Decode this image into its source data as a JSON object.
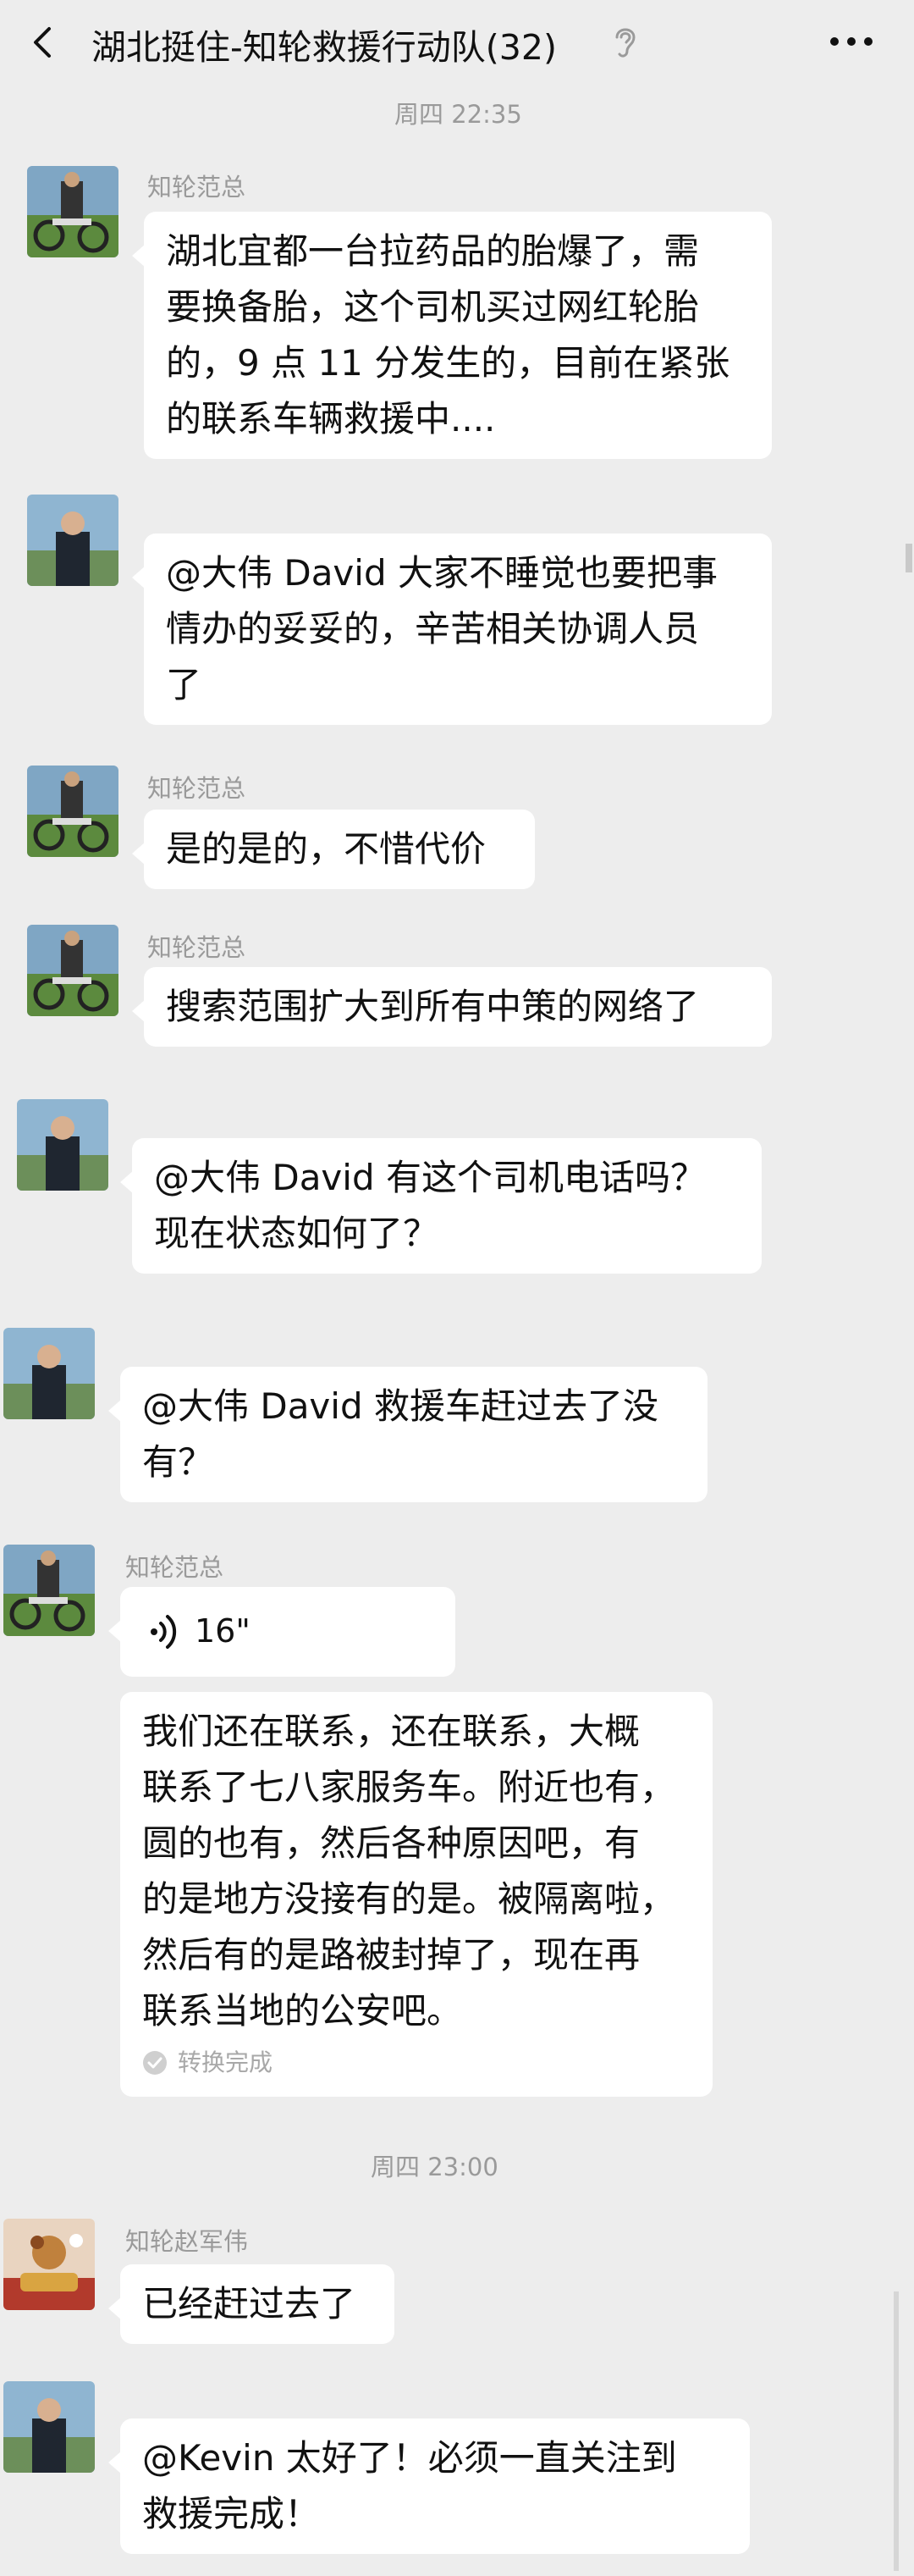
{
  "header": {
    "title": "湖北挺住-知轮救援行动队(32)"
  },
  "time_separators": [
    "周四 22:35",
    "周四 23:00"
  ],
  "messages": [
    {
      "sender": "知轮范总",
      "lines": [
        "湖北宜都一台拉药品的胎爆了，需",
        "要换备胎，这个司机买过网红轮胎",
        "的，9 点 11 分发生的，目前在紧张",
        "的联系车辆救援中...."
      ]
    },
    {
      "sender": "",
      "lines": [
        "@大伟 David  大家不睡觉也要把事",
        "情办的妥妥的，辛苦相关协调人员",
        "了"
      ]
    },
    {
      "sender": "知轮范总",
      "lines": [
        "是的是的，不惜代价"
      ]
    },
    {
      "sender": "知轮范总",
      "lines": [
        "搜索范围扩大到所有中策的网络了"
      ]
    },
    {
      "sender": "",
      "lines": [
        "@大伟 David  有这个司机电话吗？",
        "现在状态如何了？"
      ]
    },
    {
      "sender": "",
      "lines": [
        "@大伟 David  救援车赶过去了没",
        "有？"
      ]
    },
    {
      "sender": "知轮范总",
      "voice_duration": "16\"",
      "transcript_lines": [
        "我们还在联系，还在联系，大概",
        "联系了七八家服务车。附近也有，",
        "圆的也有，然后各种原因吧，有",
        "的是地方没接有的是。被隔离啦，",
        "然后有的是路被封掉了，现在再",
        "联系当地的公安吧。"
      ],
      "transcript_status": "转换完成"
    },
    {
      "sender": "知轮赵军伟",
      "lines": [
        "已经赶过去了"
      ]
    },
    {
      "sender": "",
      "lines": [
        "@Kevin  太好了！必须一直关注到",
        "救援完成！"
      ]
    }
  ],
  "colors": {
    "background": "#ededed",
    "bubble": "#ffffff",
    "meta_text": "#9a9a9a"
  }
}
